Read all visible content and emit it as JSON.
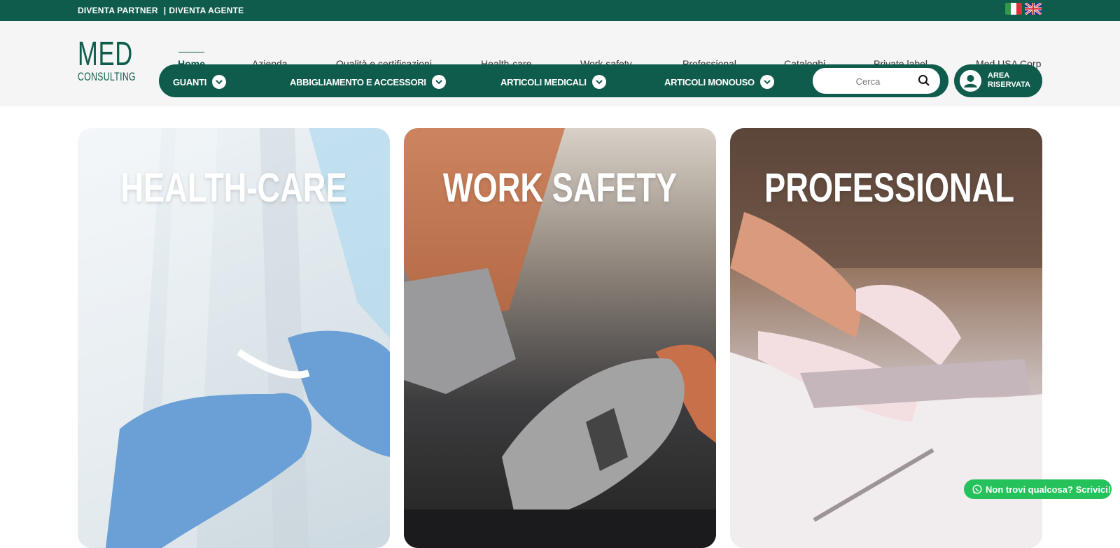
{
  "topbar": {
    "partner_link": "DIVENTA PARTNER",
    "separator": "|",
    "agent_link": "DIVENTA AGENTE",
    "flags": [
      "italian-flag",
      "uk-flag"
    ]
  },
  "logo": {
    "line1": "MED",
    "line2": "CONSULTING"
  },
  "nav": {
    "home": "Home",
    "azienda": "Azienda",
    "qualita": "Qualità e certificazioni",
    "healthcare": "Health-care",
    "worksafety": "Work safety",
    "professional": "Professional",
    "cataloghi": "Cataloghi",
    "privatelabel": "Private label",
    "medusa": "Med USA Corp"
  },
  "categories": {
    "guanti": "GUANTI",
    "abbigliamento": "ABBIGLIAMENTO E ACCESSORI",
    "medicali": "ARTICOLI MEDICALI",
    "monouso": "ARTICOLI MONOUSO"
  },
  "search": {
    "placeholder": "Cerca"
  },
  "area": {
    "line1": "AREA",
    "line2": "RISERVATA"
  },
  "cards": {
    "health": "HEALTH-CARE",
    "work": "WORK SAFETY",
    "pro": "PROFESSIONAL"
  },
  "whatsapp": {
    "label": "Non trovi qualcosa? Scrivici!"
  },
  "colors": {
    "brand": "#0f5c4d",
    "whatsapp": "#25c15a",
    "header_bg": "#f5f5f5"
  }
}
